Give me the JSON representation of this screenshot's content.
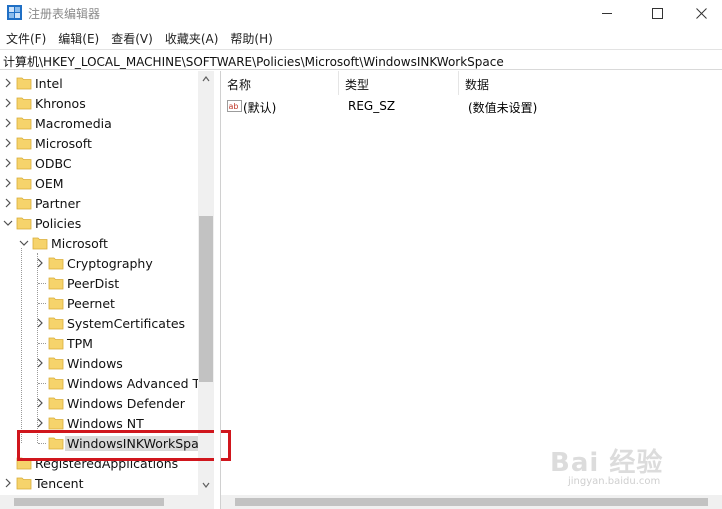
{
  "window": {
    "title": "注册表编辑器"
  },
  "menu": [
    {
      "label": "文件(F)"
    },
    {
      "label": "编辑(E)"
    },
    {
      "label": "查看(V)"
    },
    {
      "label": "收藏夹(A)"
    },
    {
      "label": "帮助(H)"
    }
  ],
  "address": "计算机\\HKEY_LOCAL_MACHINE\\SOFTWARE\\Policies\\Microsoft\\WindowsINKWorkSpace",
  "tree": [
    {
      "label": "Intel",
      "level": 0,
      "expander": "collapsed"
    },
    {
      "label": "Khronos",
      "level": 0,
      "expander": "collapsed"
    },
    {
      "label": "Macromedia",
      "level": 0,
      "expander": "collapsed"
    },
    {
      "label": "Microsoft",
      "level": 0,
      "expander": "collapsed"
    },
    {
      "label": "ODBC",
      "level": 0,
      "expander": "collapsed"
    },
    {
      "label": "OEM",
      "level": 0,
      "expander": "collapsed"
    },
    {
      "label": "Partner",
      "level": 0,
      "expander": "collapsed"
    },
    {
      "label": "Policies",
      "level": 0,
      "expander": "expanded"
    },
    {
      "label": "Microsoft",
      "level": 1,
      "expander": "expanded"
    },
    {
      "label": "Cryptography",
      "level": 2,
      "expander": "collapsed"
    },
    {
      "label": "PeerDist",
      "level": 2,
      "expander": "none"
    },
    {
      "label": "Peernet",
      "level": 2,
      "expander": "none"
    },
    {
      "label": "SystemCertificates",
      "level": 2,
      "expander": "collapsed"
    },
    {
      "label": "TPM",
      "level": 2,
      "expander": "none"
    },
    {
      "label": "Windows",
      "level": 2,
      "expander": "collapsed"
    },
    {
      "label": "Windows Advanced Th",
      "level": 2,
      "expander": "none"
    },
    {
      "label": "Windows Defender",
      "level": 2,
      "expander": "collapsed"
    },
    {
      "label": "Windows NT",
      "level": 2,
      "expander": "collapsed"
    },
    {
      "label": "WindowsINKWorkSpa",
      "level": 2,
      "expander": "none",
      "selected": true
    },
    {
      "label": "RegisteredApplications",
      "level": 0,
      "expander": "none"
    },
    {
      "label": "Tencent",
      "level": 0,
      "expander": "collapsed"
    }
  ],
  "columns": {
    "name": "名称",
    "type": "类型",
    "data": "数据"
  },
  "values": [
    {
      "name": "(默认)",
      "type": "REG_SZ",
      "data": "(数值未设置)",
      "icon": "string-value-icon"
    }
  ],
  "watermark": {
    "main": "Bai 经验",
    "sub": "jingyan.baidu.com"
  },
  "colors": {
    "highlight_box": "#d0161d",
    "folder": "#f6d36b",
    "selection": "#d9d9d9"
  }
}
